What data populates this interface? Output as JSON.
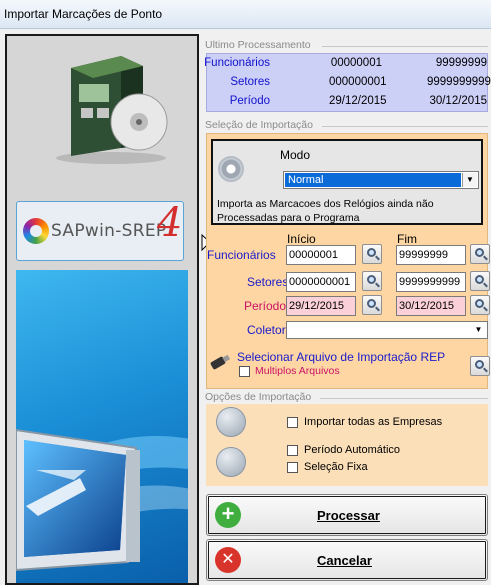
{
  "window": {
    "title": "Importar Marcações de Ponto"
  },
  "brand": {
    "name": "SAPwin-SREP",
    "version": "4"
  },
  "last_processing": {
    "title": "Ultimo Processamento",
    "rows": [
      {
        "label": "Funcionários",
        "from": "00000001",
        "to": "99999999"
      },
      {
        "label": "Setores",
        "from": "000000001",
        "to": "9999999999"
      },
      {
        "label": "Período",
        "from": "29/12/2015",
        "to": "30/12/2015"
      }
    ]
  },
  "import_selection": {
    "title": "Seleção de Importação",
    "mode_label": "Modo",
    "mode_value": "Normal",
    "mode_description": "Importa as Marcacoes dos Relógios ainda não Processadas para o Programa",
    "col_start": "Início",
    "col_end": "Fim",
    "employees_label": "Funcionários",
    "employees_from": "00000001",
    "employees_to": "99999999",
    "sectors_label": "Setores",
    "sectors_from": "0000000001",
    "sectors_to": "9999999999",
    "period_label": "Período",
    "period_from": "29/12/2015",
    "period_to": "30/12/2015",
    "collector_label": "Coletor",
    "collector_value": "",
    "select_file_label": "Selecionar Arquivo de Importação REP",
    "multiple_files_label": "Multiplos Arquivos"
  },
  "import_options": {
    "title": "Opções de Importação",
    "all_companies": "Importar todas as Empresas",
    "auto_period": "Período Automático",
    "fixed_selection": "Seleção Fixa"
  },
  "actions": {
    "process": "Processar",
    "cancel": "Cancelar"
  },
  "colors": {
    "label_blue": "#1a1acc",
    "label_pink": "#cc1166",
    "panel_lavender": "#ccd0f7",
    "panel_orange": "#fdd6a3",
    "selection_blue": "#0a6ad8"
  }
}
